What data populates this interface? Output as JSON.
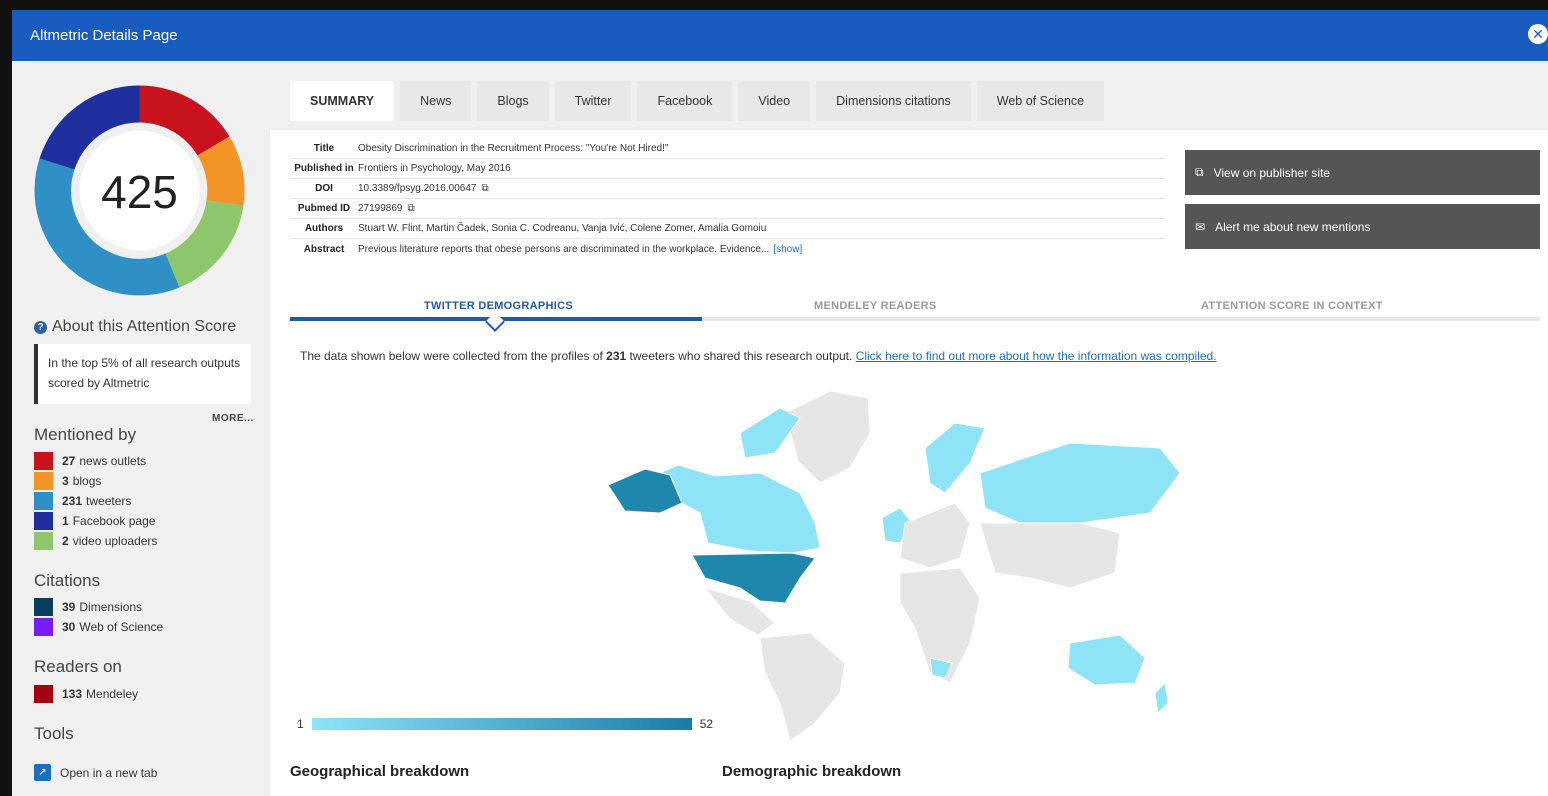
{
  "window": {
    "title": "Altmetric Details Page",
    "close_glyph": "✕"
  },
  "score": {
    "value": "425"
  },
  "sidebar": {
    "about_title": "About this Attention Score",
    "callout": "In the top 5% of all research outputs scored by Altmetric",
    "more_label": "MORE...",
    "mentioned_by": {
      "title": "Mentioned by",
      "items": [
        {
          "count": "27",
          "label": "news outlets",
          "color": "#c9131c"
        },
        {
          "count": "3",
          "label": "blogs",
          "color": "#f39427"
        },
        {
          "count": "231",
          "label": "tweeters",
          "color": "#2f90c5"
        },
        {
          "count": "1",
          "label": "Facebook page",
          "color": "#1f2f9e"
        },
        {
          "count": "2",
          "label": "video uploaders",
          "color": "#8ec66d"
        }
      ]
    },
    "citations": {
      "title": "Citations",
      "items": [
        {
          "count": "39",
          "label": "Dimensions",
          "color": "#0b3d5e"
        },
        {
          "count": "30",
          "label": "Web of Science",
          "color": "#7a1df2"
        }
      ]
    },
    "readers": {
      "title": "Readers on",
      "items": [
        {
          "count": "133",
          "label": "Mendeley",
          "color": "#a3000f"
        }
      ]
    },
    "tools": {
      "title": "Tools",
      "open_tab": "Open in a new tab"
    }
  },
  "tabs": [
    "SUMMARY",
    "News",
    "Blogs",
    "Twitter",
    "Facebook",
    "Video",
    "Dimensions citations",
    "Web of Science"
  ],
  "article": {
    "title_key": "Title",
    "title": "Obesity Discrimination in the Recruitment Process: \"You're Not Hired!\"",
    "published_key": "Published in",
    "published": "Frontiers in Psychology, May 2016",
    "doi_key": "DOI",
    "doi": "10.3389/fpsyg.2016.00647",
    "pubmed_key": "Pubmed ID",
    "pubmed": "27199869",
    "authors_key": "Authors",
    "authors": "Stuart W. Flint, Martin Čadek, Sonia C. Codreanu, Vanja Ivić, Colene Zomer, Amalia Gomoiu",
    "abstract_key": "Abstract",
    "abstract": "Previous literature reports that obese persons are discriminated in the workplace. Evidence...",
    "show_link": "[show]"
  },
  "actions": {
    "publisher": "View on publisher site",
    "alert": "Alert me about new mentions"
  },
  "subtabs": [
    "TWITTER DEMOGRAPHICS",
    "MENDELEY READERS",
    "ATTENTION SCORE IN CONTEXT"
  ],
  "demographics": {
    "intro_pre": "The data shown below were collected from the profiles of",
    "intro_count": "231",
    "intro_post": "tweeters who shared this research output.",
    "intro_link": "Click here to find out more about how the information was compiled.",
    "scale_min": "1",
    "scale_max": "52",
    "geo_title": "Geographical breakdown",
    "demo_title": "Demographic breakdown"
  }
}
